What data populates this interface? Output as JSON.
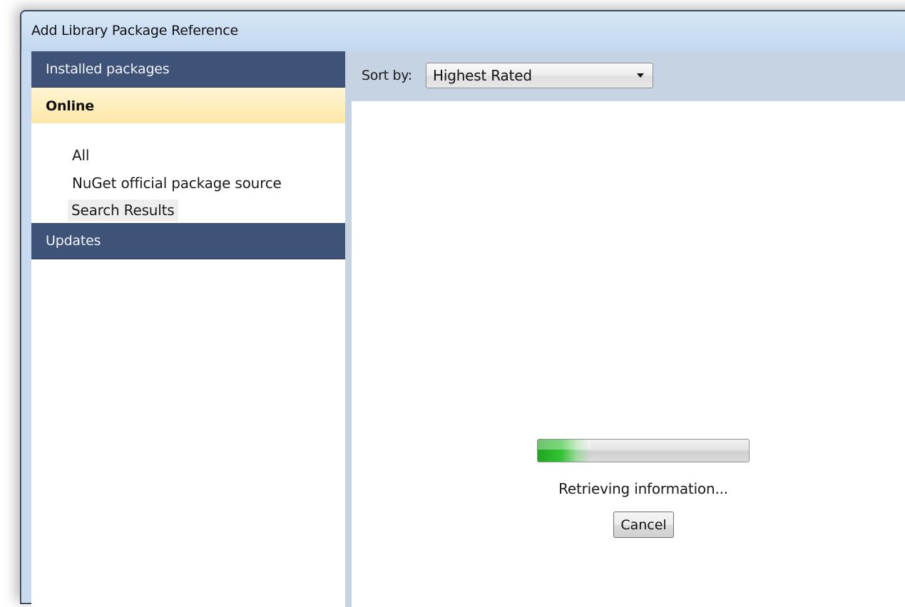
{
  "window": {
    "title": "Add Library Package Reference"
  },
  "sidebar": {
    "installed_label": "Installed packages",
    "online_label": "Online",
    "online_items": [
      {
        "label": "All"
      },
      {
        "label": "NuGet official package source"
      },
      {
        "label": "Search Results",
        "selected": true
      }
    ],
    "updates_label": "Updates"
  },
  "toolbar": {
    "sort_label": "Sort by:",
    "sort_value": "Highest Rated"
  },
  "loading": {
    "progress_fraction": 0.25,
    "status_text": "Retrieving information...",
    "cancel_label": "Cancel"
  },
  "colors": {
    "section_dark": "#3f5277",
    "section_selected": "#fde8a8",
    "progress_green": "#2db42d",
    "toolbar_bg": "#c6d3e3"
  }
}
